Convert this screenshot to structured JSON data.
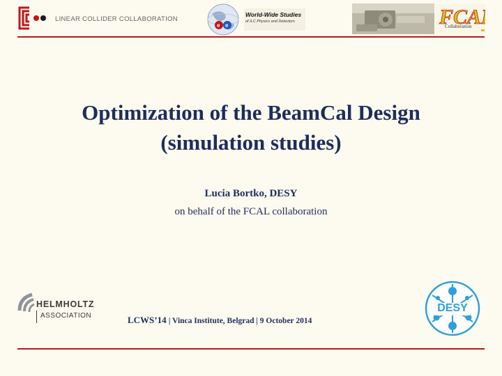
{
  "header": {
    "lcc_logo_text": "LINEAR COLLIDER COLLABORATION",
    "wws_logo_line1": "World-Wide Studies",
    "wws_logo_line2": "of ILC Physics and Detectors",
    "fcal_logo_text": "Collaboration"
  },
  "slide": {
    "title_line1": "Optimization of the BeamCal Design",
    "title_line2": "(simulation studies)",
    "author": "Lucia Bortko,  DESY",
    "affiliation_note": "on behalf of the FCAL collaboration"
  },
  "footer": {
    "helmholtz_line1": "HELMHOLTZ",
    "helmholtz_line2": "ASSOCIATION",
    "event": "LCWS’14",
    "details": "| Vinca Institute, Belgrad |  9  October 2014",
    "desy_logo_text": "DESY"
  },
  "colors": {
    "background": "#fdfaef",
    "text": "#1f2d5c",
    "rule": "#c0171d"
  }
}
